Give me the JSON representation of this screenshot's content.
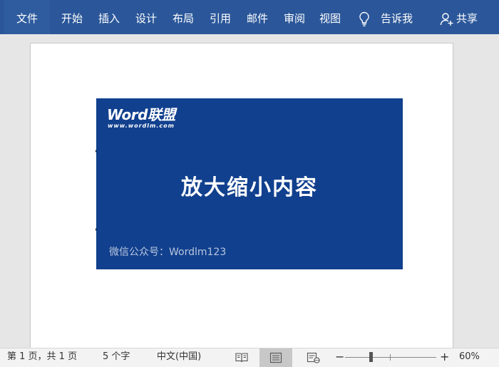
{
  "ribbon": {
    "tabs": [
      {
        "label": "文件"
      },
      {
        "label": "开始"
      },
      {
        "label": "插入"
      },
      {
        "label": "设计"
      },
      {
        "label": "布局"
      },
      {
        "label": "引用"
      },
      {
        "label": "邮件"
      },
      {
        "label": "审阅"
      },
      {
        "label": "视图"
      }
    ],
    "tell_me": "告诉我",
    "share": "共享",
    "colors": {
      "ribbon_bg": "#2b579a",
      "file_tab_bg": "#2e5c9f"
    }
  },
  "document": {
    "banner": {
      "logo_main": "Word联盟",
      "logo_sub": "www.wordlm.com",
      "headline": "放大缩小内容",
      "caption": "微信公众号：Wordlm123",
      "background": "#11408e"
    }
  },
  "status_bar": {
    "page": "第 1 页，共 1 页",
    "words": "5 个字",
    "language": "中文(中国)",
    "zoom": "60%",
    "zoom_value": 60,
    "view_modes": [
      "read-mode-icon",
      "print-layout-icon",
      "web-layout-icon"
    ],
    "active_view": "print-layout-icon"
  }
}
